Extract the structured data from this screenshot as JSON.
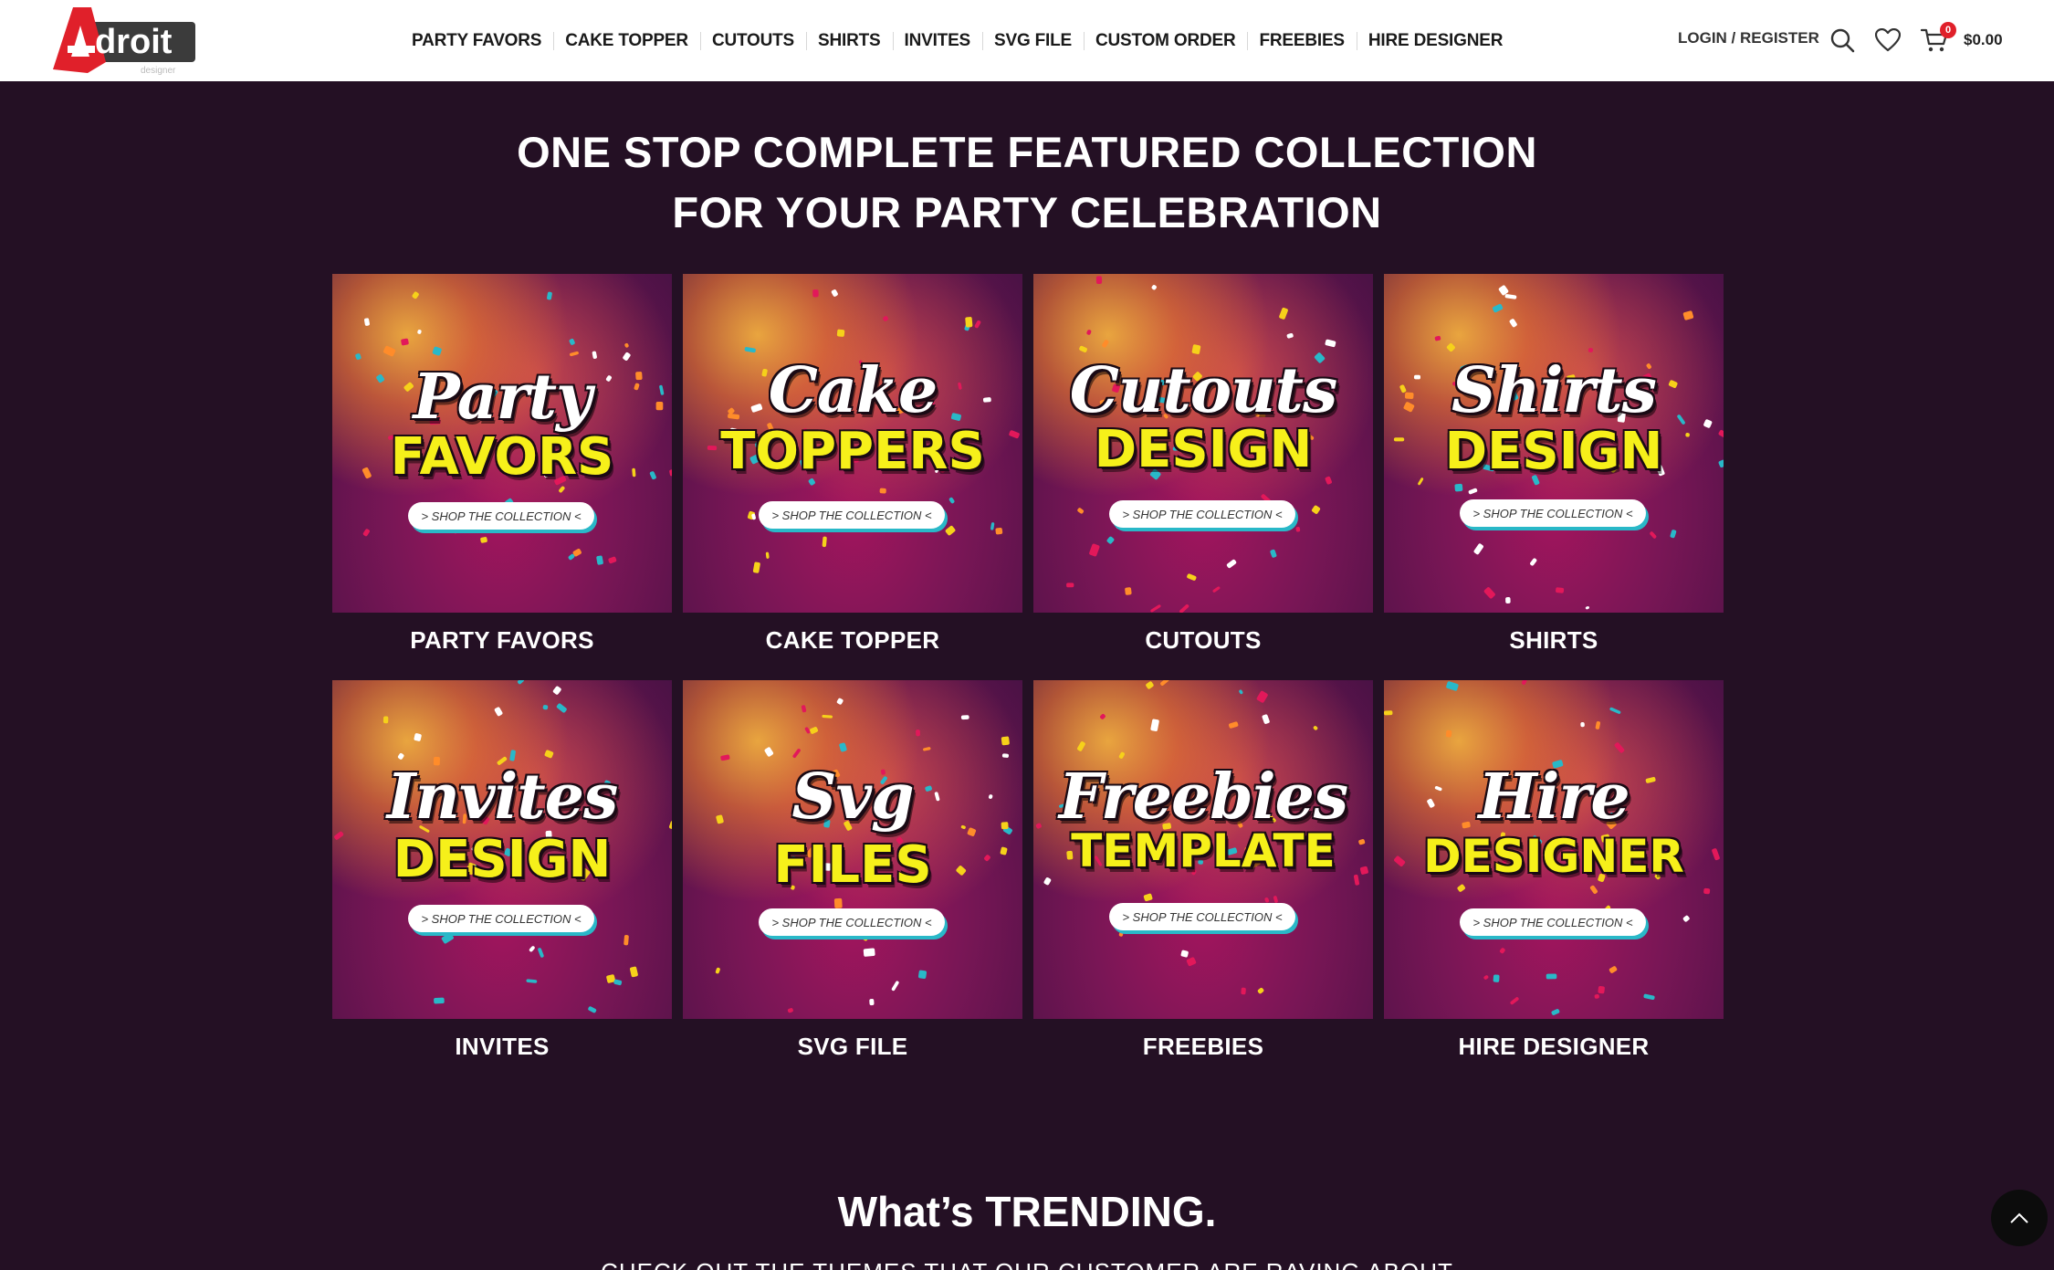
{
  "brand": {
    "logo_text": "droit",
    "logo_letter": "A",
    "logo_sub": "designer"
  },
  "nav": {
    "items": [
      "PARTY FAVORS",
      "CAKE TOPPER",
      "CUTOUTS",
      "SHIRTS",
      "INVITES",
      "SVG FILE",
      "CUSTOM ORDER",
      "FREEBIES",
      "HIRE DESIGNER"
    ]
  },
  "header": {
    "login_label": "LOGIN / REGISTER",
    "cart_count": "0",
    "cart_total": "$0.00"
  },
  "icons": {
    "search": "search-icon",
    "wishlist": "heart-icon",
    "cart": "cart-icon",
    "scroll_top": "chevron-up-icon"
  },
  "hero": {
    "line1": "ONE STOP COMPLETE FEATURED COLLECTION",
    "line2": "FOR YOUR PARTY CELEBRATION"
  },
  "categories": [
    {
      "script": "Party",
      "bold": "FAVORS",
      "pill": "> SHOP THE COLLECTION <",
      "caption": "PARTY FAVORS"
    },
    {
      "script": "Cake",
      "bold": "TOPPERS",
      "pill": "> SHOP THE COLLECTION <",
      "caption": "CAKE TOPPER"
    },
    {
      "script": "Cutouts",
      "bold": "DESIGN",
      "pill": "> SHOP THE COLLECTION <",
      "caption": "CUTOUTS"
    },
    {
      "script": "Shirts",
      "bold": "DESIGN",
      "pill": "> SHOP THE COLLECTION <",
      "caption": "SHIRTS"
    },
    {
      "script": "Invites",
      "bold": "DESIGN",
      "pill": "> SHOP THE COLLECTION <",
      "caption": "INVITES"
    },
    {
      "script": "Svg",
      "bold": "FILES",
      "pill": "> SHOP THE COLLECTION <",
      "caption": "SVG FILE"
    },
    {
      "script": "Freebies",
      "bold": "TEMPLATE",
      "pill": "> SHOP THE COLLECTION <",
      "caption": "FREEBIES"
    },
    {
      "script": "Hire",
      "bold": "DESIGNER",
      "pill": "> SHOP THE COLLECTION <",
      "caption": "HIRE DESIGNER"
    }
  ],
  "trending": {
    "title": "What’s TRENDING.",
    "subtitle": "CHECK OUT THE THEMES THAT OUR CUSTOMER ARE RAVING ABOUT"
  },
  "colors": {
    "background": "#241024",
    "accent_yellow": "#f6f01a",
    "badge_red": "#e0202a",
    "logo_red": "#e0202a"
  }
}
